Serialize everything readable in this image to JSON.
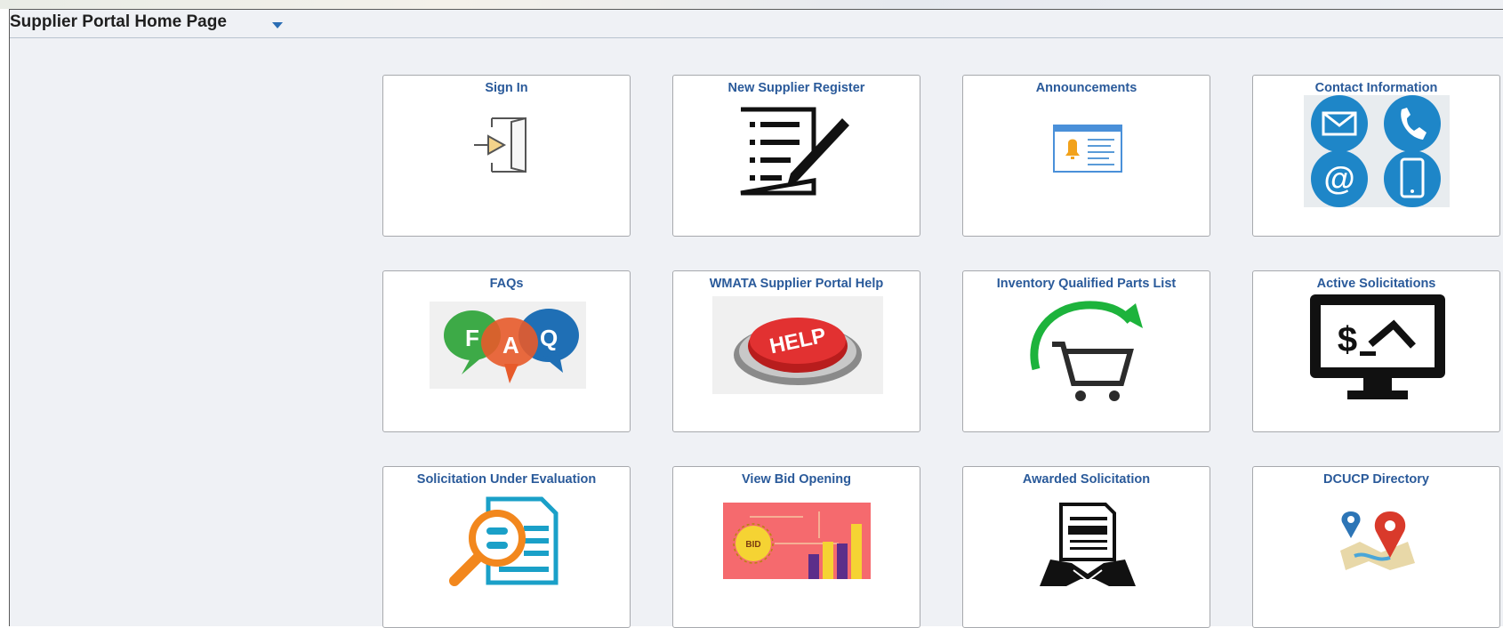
{
  "header": {
    "title": "Supplier Portal Home Page"
  },
  "tiles": [
    {
      "title": "Sign In",
      "icon": "sign-in-icon"
    },
    {
      "title": "New Supplier Register",
      "icon": "register-form-icon"
    },
    {
      "title": "Announcements",
      "icon": "announcement-icon"
    },
    {
      "title": "Contact Information",
      "icon": "contact-icons"
    },
    {
      "title": "FAQs",
      "icon": "faq-bubbles-icon"
    },
    {
      "title": "WMATA Supplier Portal Help",
      "icon": "help-button-icon"
    },
    {
      "title": "Inventory Qualified Parts List",
      "icon": "shopping-cart-icon"
    },
    {
      "title": "Active Solicitations",
      "icon": "auction-monitor-icon"
    },
    {
      "title": "Solicitation Under Evaluation",
      "icon": "document-magnifier-icon"
    },
    {
      "title": "View Bid Opening",
      "icon": "bid-chart-icon",
      "badge": "BID"
    },
    {
      "title": "Awarded Solicitation",
      "icon": "contract-handshake-icon"
    },
    {
      "title": "DCUCP Directory",
      "icon": "map-pins-icon"
    }
  ],
  "colors": {
    "tile_title": "#2a5a9a",
    "background": "#eff1f5",
    "accent": "#2a6db4"
  }
}
